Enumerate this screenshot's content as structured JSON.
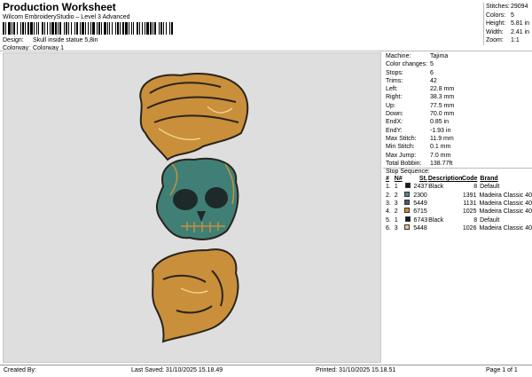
{
  "header": {
    "title": "Production Worksheet",
    "subtitle": "Wilcom EmbroideryStudio – Level 3 Advanced",
    "design_label": "Design:",
    "design_value": "Skull inside statue 5,8in",
    "colorway_label": "Colorway:",
    "colorway_value": "Colorway 1"
  },
  "stats": [
    {
      "label": "Stitches:",
      "value": "29094"
    },
    {
      "label": "Colors:",
      "value": "5"
    },
    {
      "label": "Height:",
      "value": "5.81 in"
    },
    {
      "label": "Width:",
      "value": "2.41 in"
    },
    {
      "label": "Zoom:",
      "value": "1:1"
    }
  ],
  "params": [
    {
      "label": "Machine:",
      "value": "Tajima"
    },
    {
      "label": "Color changes:",
      "value": "5"
    },
    {
      "label": "Stops:",
      "value": "6"
    },
    {
      "label": "Trims:",
      "value": "42"
    },
    {
      "label": "Left:",
      "value": "22.8 mm"
    },
    {
      "label": "Right:",
      "value": "38.3 mm"
    },
    {
      "label": "Up:",
      "value": "77.5 mm"
    },
    {
      "label": "Down:",
      "value": "70.0 mm"
    },
    {
      "label": "EndX:",
      "value": "0.85 in"
    },
    {
      "label": "EndY:",
      "value": "-1.93 in"
    },
    {
      "label": "Max Stitch:",
      "value": "11.9 mm"
    },
    {
      "label": "Min Stitch:",
      "value": "0.1 mm"
    },
    {
      "label": "Max Jump:",
      "value": "7.0 mm"
    },
    {
      "label": "Total Bobbin:",
      "value": "138.77ft"
    }
  ],
  "stop_sequence": {
    "title": "Stop Sequence:",
    "headers": [
      "#",
      "N#",
      "St.",
      "Description",
      "Code",
      "Brand"
    ],
    "rows": [
      {
        "num": "1.",
        "n": "1",
        "color": "#1a1a1a",
        "st": "2437",
        "desc": "Black",
        "code": "8",
        "brand": "Default"
      },
      {
        "num": "2.",
        "n": "2",
        "color": "#4f8a83",
        "st": "2300",
        "desc": "",
        "code": "1391",
        "brand": "Madeira Classic 40"
      },
      {
        "num": "3.",
        "n": "3",
        "color": "#4a5a6a",
        "st": "5449",
        "desc": "",
        "code": "1131",
        "brand": "Madeira Classic 40"
      },
      {
        "num": "4.",
        "n": "2",
        "color": "#d98a2b",
        "st": "6715",
        "desc": "",
        "code": "1025",
        "brand": "Madeira Classic 40"
      },
      {
        "num": "5.",
        "n": "1",
        "color": "#1a1a1a",
        "st": "6743",
        "desc": "Black",
        "code": "8",
        "brand": "Default"
      },
      {
        "num": "6.",
        "n": "3",
        "color": "#f0c48a",
        "st": "5448",
        "desc": "",
        "code": "1026",
        "brand": "Madeira Classic 40"
      }
    ]
  },
  "footer": {
    "created_by": "Created By:",
    "last_saved": "Last Saved: 31/10/2025 15.18.49",
    "printed": "Printed: 31/10/2025 15.18.51",
    "page": "Page 1 of 1"
  }
}
